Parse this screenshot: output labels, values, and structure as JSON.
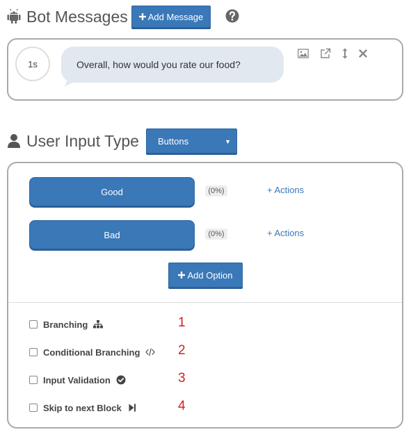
{
  "bot": {
    "title": "Bot Messages",
    "add_label": "Add Message",
    "delay": "1s",
    "message": "Overall, how would you rate our food?"
  },
  "user_input": {
    "title": "User Input Type",
    "select_value": "Buttons",
    "options": [
      {
        "label": "Good",
        "percent": "(0%)",
        "actions": "+ Actions"
      },
      {
        "label": "Bad",
        "percent": "(0%)",
        "actions": "+ Actions"
      }
    ],
    "add_option_label": "Add Option"
  },
  "settings": [
    {
      "label": "Branching",
      "number": "1",
      "icon": "sitemap-icon"
    },
    {
      "label": "Conditional Branching",
      "number": "2",
      "icon": "code-icon"
    },
    {
      "label": "Input Validation",
      "number": "3",
      "icon": "check-circle-icon"
    },
    {
      "label": "Skip to next Block",
      "number": "4",
      "icon": "step-forward-icon"
    }
  ],
  "colors": {
    "primary": "#3a78b8",
    "annotation": "#d42020",
    "bubble": "#e1e8f0"
  }
}
